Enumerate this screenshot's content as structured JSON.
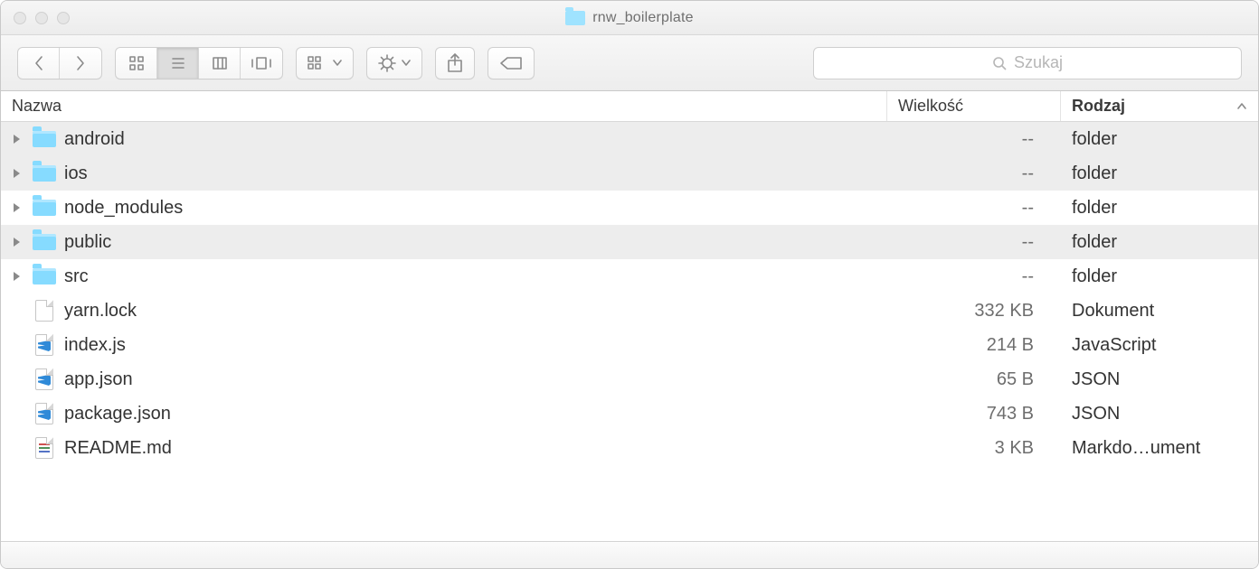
{
  "window": {
    "title": "rnw_boilerplate"
  },
  "toolbar": {
    "search_placeholder": "Szukaj"
  },
  "columns": {
    "name": "Nazwa",
    "size": "Wielkość",
    "kind": "Rodzaj"
  },
  "rows": [
    {
      "name": "android",
      "size": "--",
      "kind": "folder",
      "icon": "folder",
      "expandable": true,
      "alt": true
    },
    {
      "name": "ios",
      "size": "--",
      "kind": "folder",
      "icon": "folder",
      "expandable": true,
      "alt": true
    },
    {
      "name": "node_modules",
      "size": "--",
      "kind": "folder",
      "icon": "folder",
      "expandable": true,
      "alt": false
    },
    {
      "name": "public",
      "size": "--",
      "kind": "folder",
      "icon": "folder",
      "expandable": true,
      "alt": true
    },
    {
      "name": "src",
      "size": "--",
      "kind": "folder",
      "icon": "folder",
      "expandable": true,
      "alt": false
    },
    {
      "name": "yarn.lock",
      "size": "332 KB",
      "kind": "Dokument",
      "icon": "doc",
      "expandable": false,
      "alt": false
    },
    {
      "name": "index.js",
      "size": "214 B",
      "kind": "JavaScript",
      "icon": "vscode",
      "expandable": false,
      "alt": false
    },
    {
      "name": "app.json",
      "size": "65 B",
      "kind": "JSON",
      "icon": "vscode",
      "expandable": false,
      "alt": false
    },
    {
      "name": "package.json",
      "size": "743 B",
      "kind": "JSON",
      "icon": "vscode",
      "expandable": false,
      "alt": false
    },
    {
      "name": "README.md",
      "size": "3 KB",
      "kind": "Markdo…ument",
      "icon": "md",
      "expandable": false,
      "alt": false
    }
  ]
}
